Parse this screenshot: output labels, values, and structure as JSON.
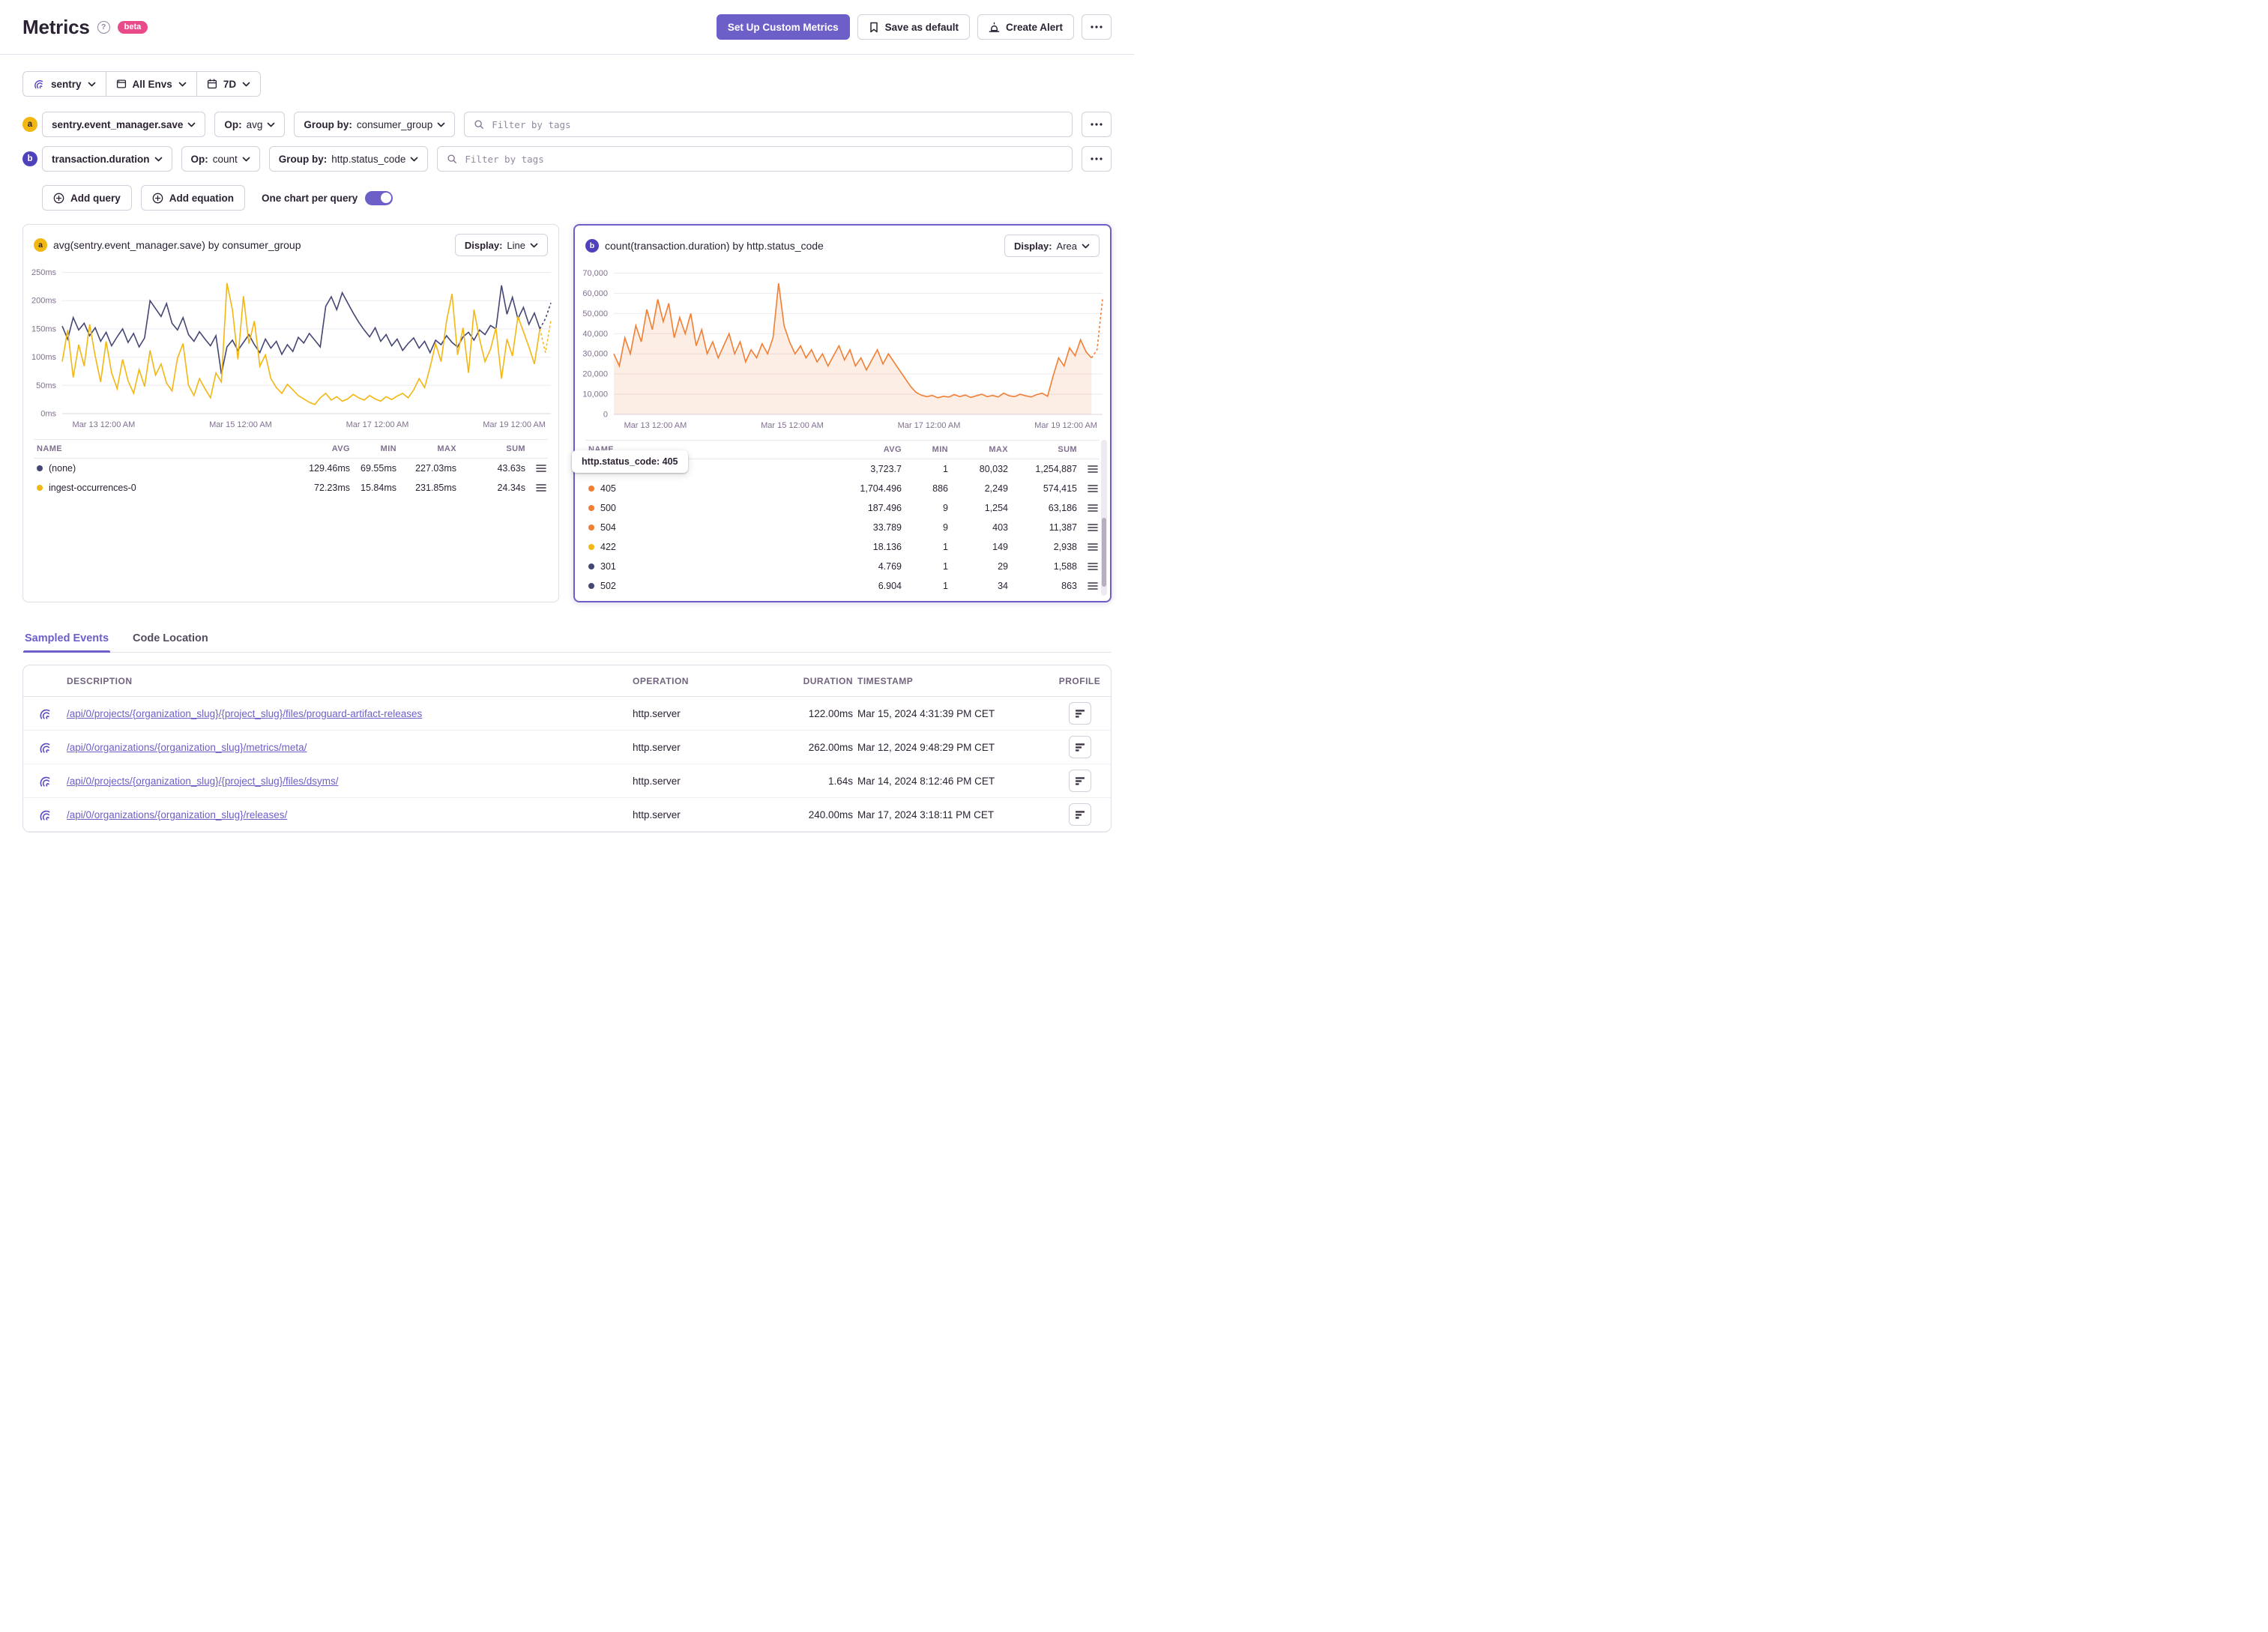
{
  "colors": {
    "accent": "#6C5FC7",
    "beta_badge": "#E94B8A",
    "query_a": "#F2B712",
    "query_b": "#4E42BC",
    "series_navy": "#444674",
    "series_yellow": "#F2B712",
    "series_orange": "#F07E33"
  },
  "icons": {
    "help": "?",
    "more": "⋯",
    "search": "magnifier",
    "add": "circled-plus",
    "save_default": "bookmark",
    "create_alert": "alarm",
    "date_range": "calendar",
    "environment": "window",
    "project": "sentry-logo",
    "profile": "flame-bars",
    "row_options": "three-lines",
    "dropdown": "chevron-down"
  },
  "header": {
    "title": "Metrics",
    "beta_badge": "beta",
    "buttons": {
      "setup": "Set Up Custom Metrics",
      "save_default": "Save as default",
      "create_alert": "Create Alert"
    }
  },
  "filters": {
    "project": "sentry",
    "environment": "All Envs",
    "date_range": "7D"
  },
  "queries": [
    {
      "badge": "a",
      "metric": "sentry.event_manager.save",
      "op_label": "Op:",
      "op": "avg",
      "groupby_label": "Group by:",
      "groupby": "consumer_group",
      "filter_placeholder": "Filter by tags"
    },
    {
      "badge": "b",
      "metric": "transaction.duration",
      "op_label": "Op:",
      "op": "count",
      "groupby_label": "Group by:",
      "groupby": "http.status_code",
      "filter_placeholder": "Filter by tags"
    }
  ],
  "toolbar": {
    "add_query": "Add query",
    "add_equation": "Add equation",
    "one_chart_label": "One chart per query",
    "one_chart_on": true
  },
  "chart_data": [
    {
      "type": "line",
      "badge": "a",
      "title": "avg(sentry.event_manager.save) by consumer_group",
      "display_label": "Display:",
      "display": "Line",
      "ylim": [
        0,
        250
      ],
      "y_ticks": [
        0,
        50,
        100,
        150,
        200,
        250
      ],
      "y_tick_labels": [
        "0ms",
        "50ms",
        "100ms",
        "150ms",
        "200ms",
        "250ms"
      ],
      "x_ticks": [
        "Mar 13 12:00 AM",
        "Mar 15 12:00 AM",
        "Mar 17 12:00 AM",
        "Mar 19 12:00 AM"
      ],
      "series": [
        {
          "name": "(none)",
          "color": "#444674",
          "values": [
            155,
            132,
            170,
            148,
            160,
            138,
            152,
            128,
            144,
            120,
            136,
            150,
            126,
            142,
            118,
            134,
            200,
            186,
            172,
            195,
            160,
            148,
            170,
            140,
            128,
            145,
            132,
            120,
            138,
            70,
            118,
            130,
            112,
            126,
            140,
            122,
            108,
            132,
            116,
            128,
            105,
            122,
            110,
            135,
            125,
            142,
            130,
            118,
            190,
            207,
            184,
            214,
            196,
            178,
            162,
            148,
            136,
            152,
            128,
            140,
            120,
            132,
            112,
            124,
            134,
            116,
            128,
            108,
            130,
            122,
            138,
            126,
            118,
            136,
            144,
            130,
            148,
            140,
            156,
            150,
            227,
            176,
            206,
            168,
            188,
            158,
            178,
            150,
            168,
            196
          ]
        },
        {
          "name": "ingest-occurrences-0",
          "color": "#F2B712",
          "values": [
            92,
            148,
            64,
            122,
            84,
            158,
            102,
            56,
            128,
            72,
            44,
            96,
            58,
            36,
            78,
            48,
            112,
            68,
            88,
            54,
            40,
            98,
            124,
            50,
            32,
            62,
            44,
            28,
            72,
            56,
            231,
            184,
            96,
            208,
            124,
            164,
            84,
            104,
            62,
            46,
            36,
            52,
            42,
            32,
            26,
            20,
            16,
            28,
            36,
            24,
            30,
            22,
            26,
            34,
            28,
            24,
            32,
            26,
            22,
            30,
            25,
            31,
            36,
            28,
            42,
            62,
            46,
            82,
            124,
            92,
            164,
            212,
            104,
            152,
            72,
            184,
            132,
            92,
            114,
            152,
            62,
            132,
            102,
            172,
            145,
            118,
            88,
            150,
            108,
            165
          ]
        }
      ],
      "summary": {
        "columns": [
          "NAME",
          "AVG",
          "MIN",
          "MAX",
          "SUM"
        ],
        "rows": [
          {
            "name": "(none)",
            "color": "#444674",
            "avg": "129.46ms",
            "min": "69.55ms",
            "max": "227.03ms",
            "sum": "43.63s"
          },
          {
            "name": "ingest-occurrences-0",
            "color": "#F2B712",
            "avg": "72.23ms",
            "min": "15.84ms",
            "max": "231.85ms",
            "sum": "24.34s"
          }
        ]
      }
    },
    {
      "type": "area",
      "badge": "b",
      "title": "count(transaction.duration) by http.status_code",
      "display_label": "Display:",
      "display": "Area",
      "ylim": [
        0,
        70000
      ],
      "y_ticks": [
        0,
        10000,
        20000,
        30000,
        40000,
        50000,
        60000,
        70000
      ],
      "y_tick_labels": [
        "0",
        "10,000",
        "20,000",
        "30,000",
        "40,000",
        "50,000",
        "60,000",
        "70,000"
      ],
      "x_ticks": [
        "Mar 13 12:00 AM",
        "Mar 15 12:00 AM",
        "Mar 17 12:00 AM",
        "Mar 19 12:00 AM"
      ],
      "tooltip": "http.status_code: 405",
      "series": [
        {
          "name": "405",
          "color": "#F07E33",
          "fill": "rgba(240,126,51,0.13)",
          "values": [
            30000,
            24000,
            38000,
            30000,
            44000,
            36000,
            52000,
            42000,
            57000,
            46000,
            55000,
            38000,
            48000,
            40000,
            50000,
            34000,
            42000,
            30000,
            36000,
            28000,
            34000,
            40000,
            30000,
            36000,
            26000,
            32000,
            28000,
            35000,
            30000,
            38000,
            65000,
            44000,
            36000,
            30000,
            34000,
            28000,
            32000,
            26000,
            30000,
            24000,
            29000,
            34000,
            27000,
            32000,
            24000,
            28000,
            22000,
            27000,
            32000,
            25000,
            30000,
            26000,
            22000,
            18000,
            14000,
            11000,
            9500,
            8800,
            9400,
            8200,
            9000,
            8600,
            9800,
            8800,
            9600,
            8400,
            9200,
            10000,
            8800,
            9400,
            8600,
            10500,
            9200,
            8800,
            10000,
            9200,
            8600,
            9800,
            10500,
            9000,
            19000,
            28000,
            24000,
            33000,
            29000,
            37000,
            31000,
            28000,
            32000,
            57000
          ]
        }
      ],
      "summary": {
        "columns": [
          "NAME",
          "AVG",
          "MIN",
          "MAX",
          "SUM"
        ],
        "rows": [
          {
            "name": "",
            "color": "",
            "avg": "3,723.7",
            "min": "1",
            "max": "80,032",
            "sum": "1,254,887"
          },
          {
            "name": "405",
            "color": "#F07E33",
            "avg": "1,704.496",
            "min": "886",
            "max": "2,249",
            "sum": "574,415"
          },
          {
            "name": "500",
            "color": "#F07E33",
            "avg": "187.496",
            "min": "9",
            "max": "1,254",
            "sum": "63,186"
          },
          {
            "name": "504",
            "color": "#F07E33",
            "avg": "33.789",
            "min": "9",
            "max": "403",
            "sum": "11,387"
          },
          {
            "name": "422",
            "color": "#F2B712",
            "avg": "18.136",
            "min": "1",
            "max": "149",
            "sum": "2,938"
          },
          {
            "name": "301",
            "color": "#444674",
            "avg": "4.769",
            "min": "1",
            "max": "29",
            "sum": "1,588"
          },
          {
            "name": "502",
            "color": "#444674",
            "avg": "6.904",
            "min": "1",
            "max": "34",
            "sum": "863"
          }
        ]
      }
    }
  ],
  "tabs": [
    {
      "label": "Sampled Events",
      "active": true
    },
    {
      "label": "Code Location",
      "active": false
    }
  ],
  "events": {
    "columns": [
      "DESCRIPTION",
      "OPERATION",
      "DURATION",
      "TIMESTAMP",
      "PROFILE"
    ],
    "rows": [
      {
        "description": "/api/0/projects/{organization_slug}/{project_slug}/files/proguard-artifact-releases",
        "operation": "http.server",
        "duration": "122.00ms",
        "timestamp": "Mar 15, 2024 4:31:39 PM CET"
      },
      {
        "description": "/api/0/organizations/{organization_slug}/metrics/meta/",
        "operation": "http.server",
        "duration": "262.00ms",
        "timestamp": "Mar 12, 2024 9:48:29 PM CET"
      },
      {
        "description": "/api/0/projects/{organization_slug}/{project_slug}/files/dsyms/",
        "operation": "http.server",
        "duration": "1.64s",
        "timestamp": "Mar 14, 2024 8:12:46 PM CET"
      },
      {
        "description": "/api/0/organizations/{organization_slug}/releases/",
        "operation": "http.server",
        "duration": "240.00ms",
        "timestamp": "Mar 17, 2024 3:18:11 PM CET"
      }
    ]
  }
}
